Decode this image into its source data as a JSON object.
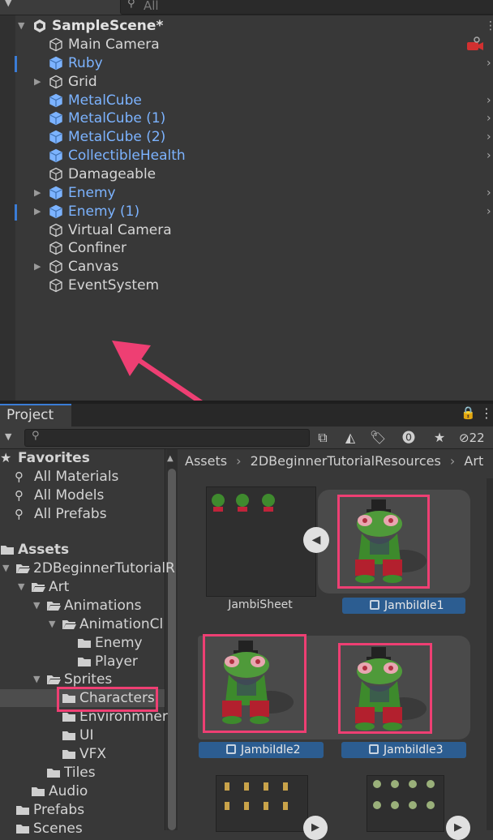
{
  "hierarchy": {
    "search_placeholder": "All",
    "scene_name": "SampleScene*",
    "items": [
      {
        "label": "Main Camera",
        "color": "white",
        "fold": false
      },
      {
        "label": "Ruby",
        "color": "blue",
        "fold": false
      },
      {
        "label": "Grid",
        "color": "white",
        "fold": true
      },
      {
        "label": "MetalCube",
        "color": "blue",
        "fold": false
      },
      {
        "label": "MetalCube (1)",
        "color": "blue",
        "fold": false
      },
      {
        "label": "MetalCube (2)",
        "color": "blue",
        "fold": false
      },
      {
        "label": "CollectibleHealth",
        "color": "blue",
        "fold": false
      },
      {
        "label": "Damageable",
        "color": "white",
        "fold": false
      },
      {
        "label": "Enemy",
        "color": "blue",
        "fold": true
      },
      {
        "label": "Enemy (1)",
        "color": "blue",
        "fold": true
      },
      {
        "label": "Virtual Camera",
        "color": "white",
        "fold": false
      },
      {
        "label": "Confiner",
        "color": "white",
        "fold": false
      },
      {
        "label": "Canvas",
        "color": "white",
        "fold": true
      },
      {
        "label": "EventSystem",
        "color": "white",
        "fold": false
      }
    ]
  },
  "project": {
    "tab_label": "Project",
    "hidden_count": "22",
    "favorites": {
      "title": "Favorites",
      "items": [
        "All Materials",
        "All Models",
        "All Prefabs"
      ]
    },
    "assets_root": "Assets",
    "tree": [
      {
        "label": "2DBeginnerTutorialR",
        "indent": 1,
        "fold": "open"
      },
      {
        "label": "Art",
        "indent": 2,
        "fold": "open"
      },
      {
        "label": "Animations",
        "indent": 3,
        "fold": "open"
      },
      {
        "label": "AnimationCl",
        "indent": 4,
        "fold": "open"
      },
      {
        "label": "Enemy",
        "indent": 5,
        "fold": "none"
      },
      {
        "label": "Player",
        "indent": 5,
        "fold": "none"
      },
      {
        "label": "Sprites",
        "indent": 3,
        "fold": "open"
      },
      {
        "label": "Characters",
        "indent": 4,
        "fold": "none",
        "selected": true
      },
      {
        "label": "Environmner",
        "indent": 4,
        "fold": "none"
      },
      {
        "label": "UI",
        "indent": 4,
        "fold": "none"
      },
      {
        "label": "VFX",
        "indent": 4,
        "fold": "none"
      },
      {
        "label": "Tiles",
        "indent": 3,
        "fold": "none"
      },
      {
        "label": "Audio",
        "indent": 2,
        "fold": "none"
      },
      {
        "label": "Prefabs",
        "indent": 1,
        "fold": "none"
      },
      {
        "label": "Scenes",
        "indent": 1,
        "fold": "none"
      }
    ],
    "breadcrumb": [
      "Assets",
      "2DBeginnerTutorialResources",
      "Art"
    ],
    "assets": [
      {
        "label": "JambiSheet"
      },
      {
        "label": "JambiIdle1"
      },
      {
        "label": "JambiIdle2"
      },
      {
        "label": "JambiIdle3"
      }
    ]
  },
  "colors": {
    "accent_blue": "#3a7cd6",
    "highlight_pink": "#ee3f73",
    "prefab_blue": "#7cb3ff"
  }
}
